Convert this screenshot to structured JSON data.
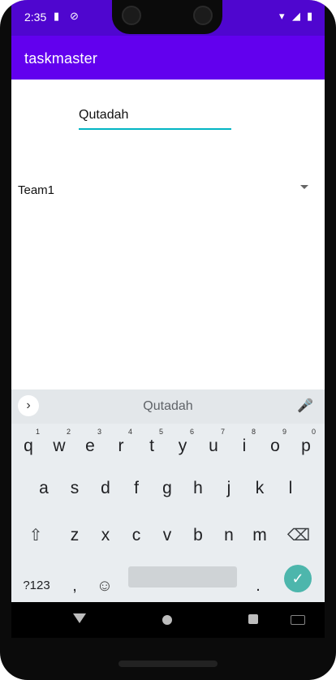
{
  "status": {
    "time": "2:35",
    "icons": [
      "sd-card-icon",
      "no-sim-icon",
      "wifi-icon",
      "signal-icon",
      "battery-icon"
    ]
  },
  "app": {
    "title": "taskmaster"
  },
  "form": {
    "name_value": "Qutadah",
    "team_selected": "Team1"
  },
  "keyboard": {
    "suggestion": "Qutadah",
    "rows": [
      [
        "q",
        "w",
        "e",
        "r",
        "t",
        "y",
        "u",
        "i",
        "o",
        "p"
      ],
      [
        "a",
        "s",
        "d",
        "f",
        "g",
        "h",
        "j",
        "k",
        "l"
      ],
      [
        "z",
        "x",
        "c",
        "v",
        "b",
        "n",
        "m"
      ]
    ],
    "hints": [
      "1",
      "2",
      "3",
      "4",
      "5",
      "6",
      "7",
      "8",
      "9",
      "0"
    ],
    "symbols_label": "?123",
    "comma_label": ",",
    "period_label": "."
  },
  "colors": {
    "statusbar": "#4f06cf",
    "appbar": "#6200ee",
    "input_underline": "#03b5c4",
    "enter_key": "#4db6ac"
  }
}
